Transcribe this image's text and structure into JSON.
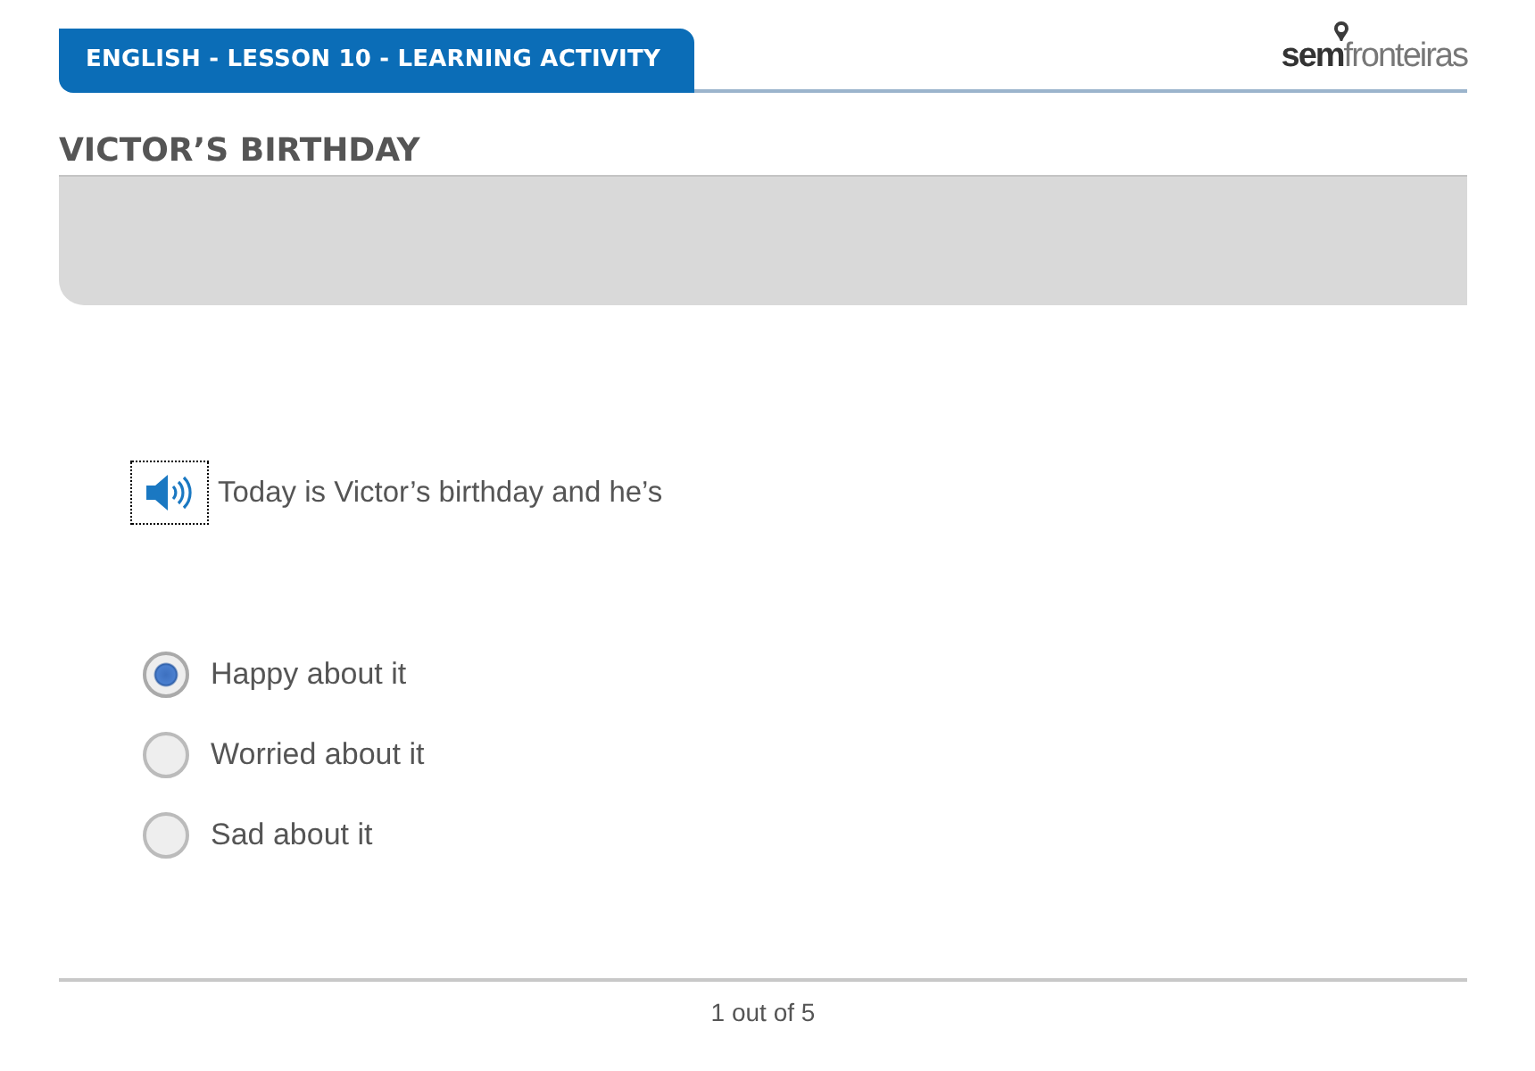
{
  "header": {
    "title": "ENGLISH - LESSON 10 - LEARNING ACTIVITY",
    "logo": "**sem**fronteiras"
  },
  "activity": {
    "title": "VICTOR’S BIRTHDAY"
  },
  "question": {
    "prompt": "Today is Victor’s birthday and he’s",
    "options": [
      {
        "label": "Happy about it",
        "selected": true
      },
      {
        "label": "Worried about it",
        "selected": false
      },
      {
        "label": "Sad about it",
        "selected": false
      }
    ]
  },
  "footer": {
    "progress": "1 out of 5"
  }
}
